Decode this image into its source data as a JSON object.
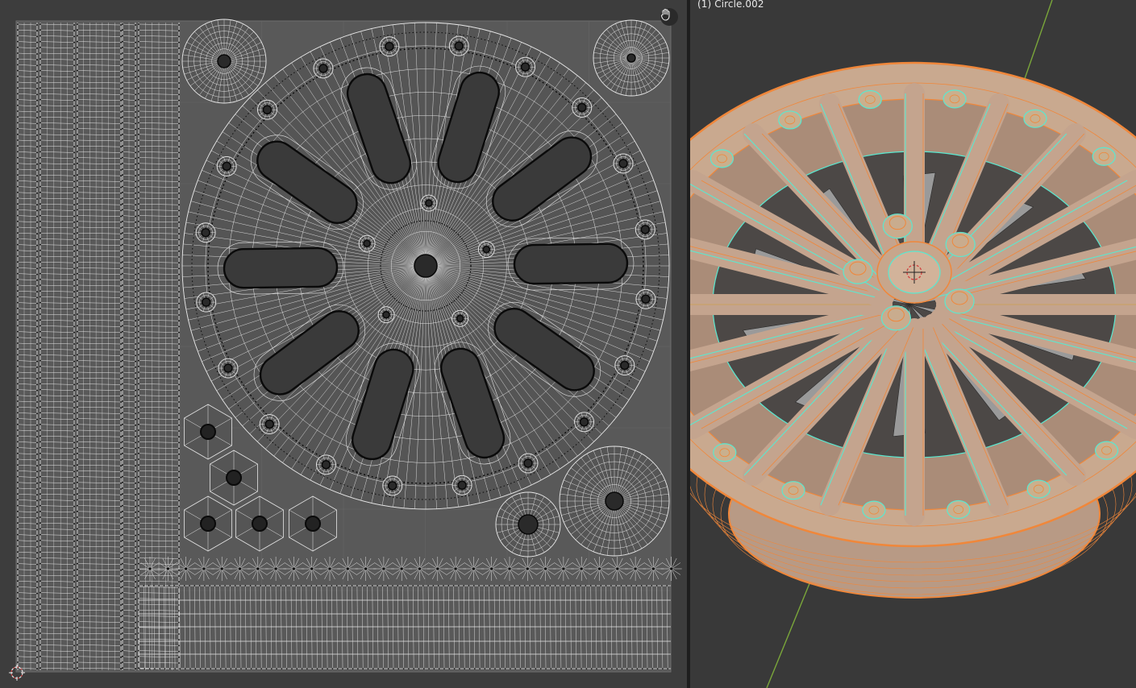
{
  "viewport": {
    "object_label": "(1) Circle.002"
  },
  "uv_editor": {
    "tools": [
      "pan-hand-icon",
      "cursor-2d-icon"
    ]
  },
  "colors": {
    "editor_bg": "#3d3d3d",
    "uv_tile": "#5a5a5a",
    "wire": "#e6e6e6",
    "vertex": "#0a0a0a",
    "selected_orange": "#f0873a",
    "active_cyan": "#5ae8d0",
    "axis_green": "#7aa63a",
    "rim_face": "#c9a98f"
  }
}
